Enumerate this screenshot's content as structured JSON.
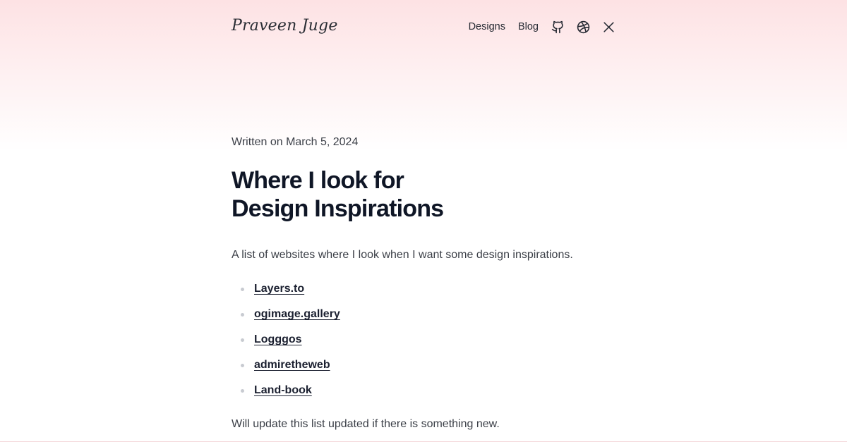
{
  "header": {
    "logo_text": "Praveen Juge",
    "nav": {
      "designs_label": "Designs",
      "blog_label": "Blog",
      "icons": [
        "github-icon",
        "dribbble-icon",
        "x-icon"
      ]
    }
  },
  "post": {
    "date_text": "Written on March 5, 2024",
    "title_line1": "Where I look for",
    "title_line2": "Design Inspirations",
    "intro": "A list of websites where I look when I want some design inspirations.",
    "links": [
      {
        "label": "Layers.to"
      },
      {
        "label": "ogimage.gallery"
      },
      {
        "label": "Logggos"
      },
      {
        "label": "admiretheweb"
      },
      {
        "label": "Land-book"
      }
    ],
    "outro": "Will update this list updated if there is something new."
  },
  "colors": {
    "gradient_top": "#fde2e4",
    "text_heading": "#0f1626",
    "text_body": "#3b3f47"
  }
}
